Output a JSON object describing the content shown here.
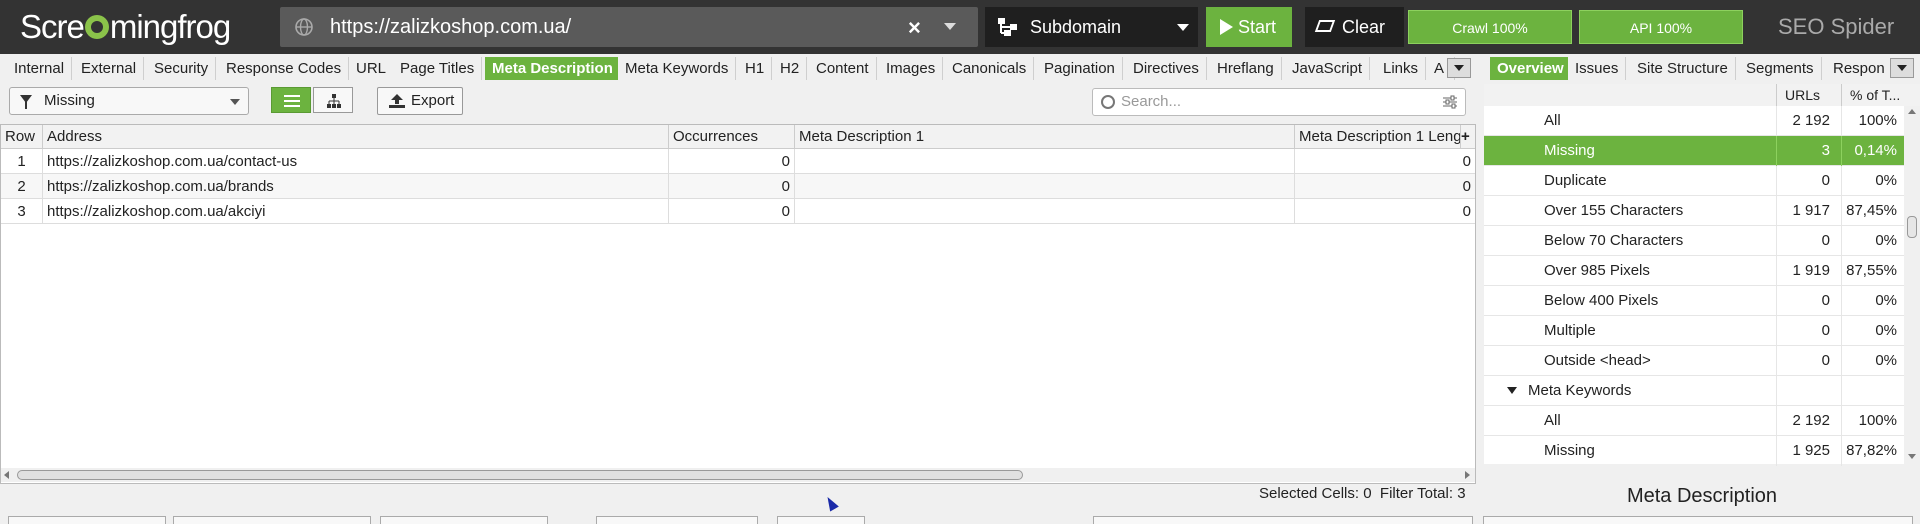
{
  "app": {
    "logo_text": "Screamingfrog",
    "brand": "SEO Spider"
  },
  "urlbar": {
    "value": "https://zalizkoshop.com.ua/",
    "clear_label": "×"
  },
  "mode": {
    "label": "Subdomain"
  },
  "buttons": {
    "start": "Start",
    "clear": "Clear",
    "crawl": "Crawl 100%",
    "api": "API 100%"
  },
  "main_tabs": [
    "Internal",
    "External",
    "Security",
    "Response Codes",
    "URL",
    "Page Titles",
    "Meta Description",
    "Meta Keywords",
    "H1",
    "H2",
    "Content",
    "Images",
    "Canonicals",
    "Pagination",
    "Directives",
    "Hreflang",
    "JavaScript",
    "Links",
    "A"
  ],
  "active_tab": "Meta Description",
  "right_tabs": [
    "Overview",
    "Issues",
    "Site Structure",
    "Segments",
    "Respons"
  ],
  "toolbar": {
    "filter_value": "Missing",
    "export_label": "Export",
    "search_placeholder": "Search..."
  },
  "grid": {
    "columns": [
      "Row",
      "Address",
      "Occurrences",
      "Meta Description 1",
      "Meta Description 1 Leng"
    ],
    "rows": [
      [
        "1",
        "https://zalizkoshop.com.ua/contact-us",
        "0",
        "",
        "0"
      ],
      [
        "2",
        "https://zalizkoshop.com.ua/brands",
        "0",
        "",
        "0"
      ],
      [
        "3",
        "https://zalizkoshop.com.ua/akciyi",
        "0",
        "",
        "0"
      ]
    ],
    "add_col": "+"
  },
  "status": {
    "selected_cells_label": "Selected Cells:",
    "selected_cells_value": "0",
    "filter_total_label": "Filter Total:",
    "filter_total_value": "3"
  },
  "overview": {
    "columns": [
      "URLs",
      "% of T..."
    ],
    "rows": [
      {
        "label": "All",
        "urls": "2 192",
        "pct": "100%"
      },
      {
        "label": "Missing",
        "urls": "3",
        "pct": "0,14%",
        "selected": true
      },
      {
        "label": "Duplicate",
        "urls": "0",
        "pct": "0%"
      },
      {
        "label": "Over 155 Characters",
        "urls": "1 917",
        "pct": "87,45%"
      },
      {
        "label": "Below 70 Characters",
        "urls": "0",
        "pct": "0%"
      },
      {
        "label": "Over 985 Pixels",
        "urls": "1 919",
        "pct": "87,55%"
      },
      {
        "label": "Below 400 Pixels",
        "urls": "0",
        "pct": "0%"
      },
      {
        "label": "Multiple",
        "urls": "0",
        "pct": "0%"
      },
      {
        "label": "Outside <head>",
        "urls": "0",
        "pct": "0%"
      },
      {
        "label": "Meta Keywords",
        "urls": "",
        "pct": "",
        "group": true
      },
      {
        "label": "All",
        "urls": "2 192",
        "pct": "100%"
      },
      {
        "label": "Missing",
        "urls": "1 925",
        "pct": "87,82%"
      }
    ],
    "footer_title": "Meta Description"
  },
  "colors": {
    "accent": "#6cb33f",
    "topbar": "#333333"
  }
}
